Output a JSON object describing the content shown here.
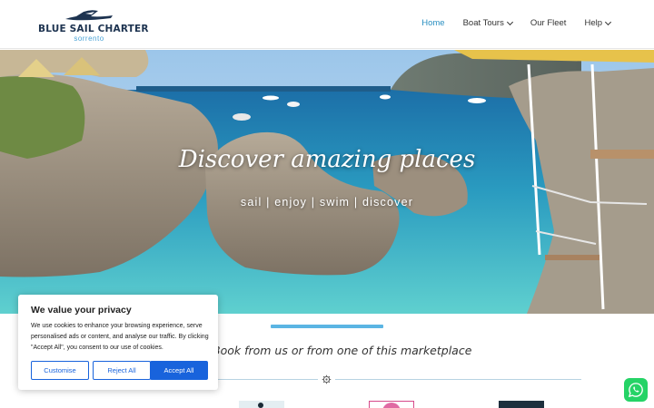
{
  "header": {
    "logo_title": "BLUE SAIL CHARTER",
    "logo_subtitle": "sorrento",
    "nav": [
      {
        "label": "Home",
        "active": true,
        "has_dropdown": false
      },
      {
        "label": "Boat Tours",
        "active": false,
        "has_dropdown": true
      },
      {
        "label": "Our Fleet",
        "active": false,
        "has_dropdown": false
      },
      {
        "label": "Help",
        "active": false,
        "has_dropdown": true
      }
    ]
  },
  "hero": {
    "title": "Discover amazing places",
    "subtitle": "sail | enjoy | swim | discover"
  },
  "section": {
    "heading": "Book from us or from one of this marketplace",
    "divider_icon": "gear-icon"
  },
  "cookie_banner": {
    "title": "We value your privacy",
    "body": "We use cookies to enhance your browsing experience, serve personalised ads or content, and analyse our traffic. By clicking \"Accept All\", you consent to our use of cookies.",
    "customise_label": "Customise",
    "reject_label": "Reject All",
    "accept_label": "Accept All"
  },
  "colors": {
    "accent": "#2a8fc1",
    "accent_bar": "#5bb5e3",
    "brand_navy": "#1d3350",
    "cookie_button": "#1863dc",
    "whatsapp": "#25d366"
  },
  "icons": {
    "logo": "boat-icon",
    "floating_button": "whatsapp-icon"
  }
}
